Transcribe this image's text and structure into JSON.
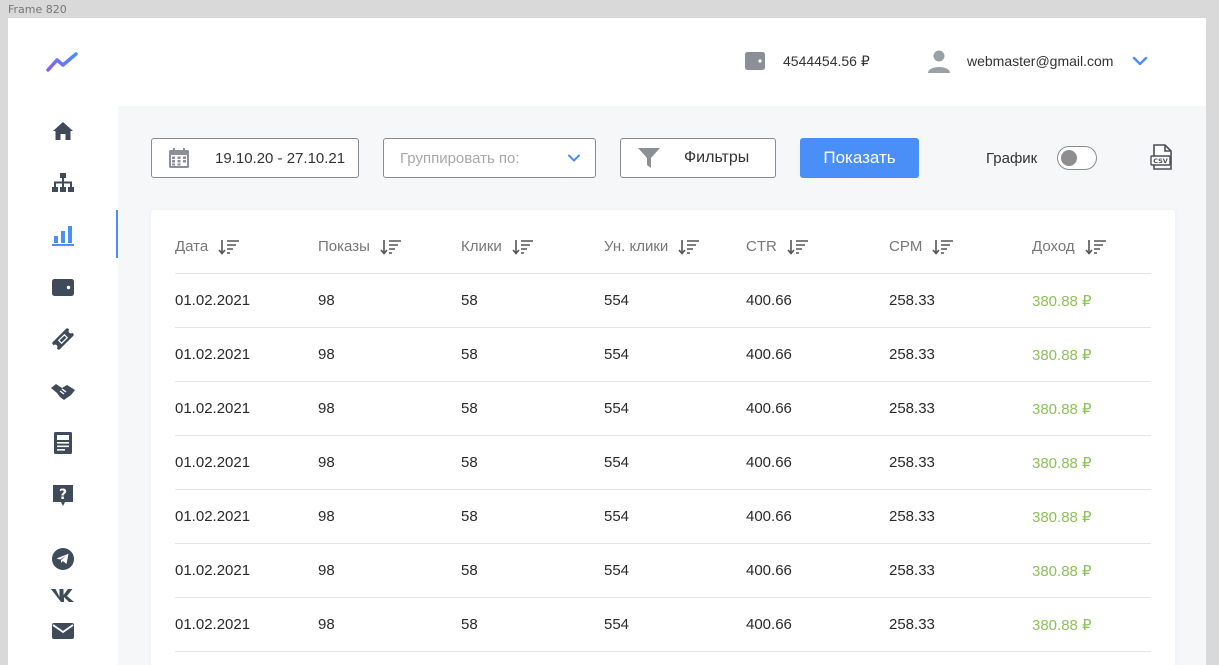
{
  "frame": {
    "label": "Frame 820"
  },
  "header": {
    "balance": "4544454.56 ₽",
    "user_email": "webmaster@gmail.com"
  },
  "sidebar": {
    "items": [
      {
        "name": "home",
        "icon": "home-icon",
        "active": false
      },
      {
        "name": "sitemap",
        "icon": "sitemap-icon",
        "active": false
      },
      {
        "name": "statistics",
        "icon": "bar-chart-icon",
        "active": true
      },
      {
        "name": "wallet",
        "icon": "wallet-icon",
        "active": false
      },
      {
        "name": "tickets",
        "icon": "ticket-icon",
        "active": false
      },
      {
        "name": "partners",
        "icon": "handshake-icon",
        "active": false
      },
      {
        "name": "news",
        "icon": "newspaper-icon",
        "active": false
      },
      {
        "name": "help",
        "icon": "question-icon",
        "active": false
      }
    ],
    "social": [
      {
        "name": "telegram",
        "icon": "telegram-icon"
      },
      {
        "name": "vk",
        "icon": "vk-icon"
      },
      {
        "name": "email",
        "icon": "mail-icon"
      }
    ]
  },
  "toolbar": {
    "date_range": "19.10.20 - 27.10.21",
    "group_placeholder": "Группировать по:",
    "filters_label": "Фильтры",
    "show_label": "Показать",
    "chart_label": "График",
    "chart_enabled": false
  },
  "table": {
    "columns": [
      "Дата",
      "Показы",
      "Клики",
      "Ун. клики",
      "CTR",
      "CPM",
      "Доход"
    ],
    "rows": [
      [
        "01.02.2021",
        "98",
        "58",
        "554",
        "400.66",
        "258.33",
        "380.88 ₽"
      ],
      [
        "01.02.2021",
        "98",
        "58",
        "554",
        "400.66",
        "258.33",
        "380.88 ₽"
      ],
      [
        "01.02.2021",
        "98",
        "58",
        "554",
        "400.66",
        "258.33",
        "380.88 ₽"
      ],
      [
        "01.02.2021",
        "98",
        "58",
        "554",
        "400.66",
        "258.33",
        "380.88 ₽"
      ],
      [
        "01.02.2021",
        "98",
        "58",
        "554",
        "400.66",
        "258.33",
        "380.88 ₽"
      ],
      [
        "01.02.2021",
        "98",
        "58",
        "554",
        "400.66",
        "258.33",
        "380.88 ₽"
      ],
      [
        "01.02.2021",
        "98",
        "58",
        "554",
        "400.66",
        "258.33",
        "380.88 ₽"
      ]
    ]
  },
  "colors": {
    "accent": "#4a8ef8",
    "income": "#8dc15b",
    "icon": "#3f4a5a"
  }
}
